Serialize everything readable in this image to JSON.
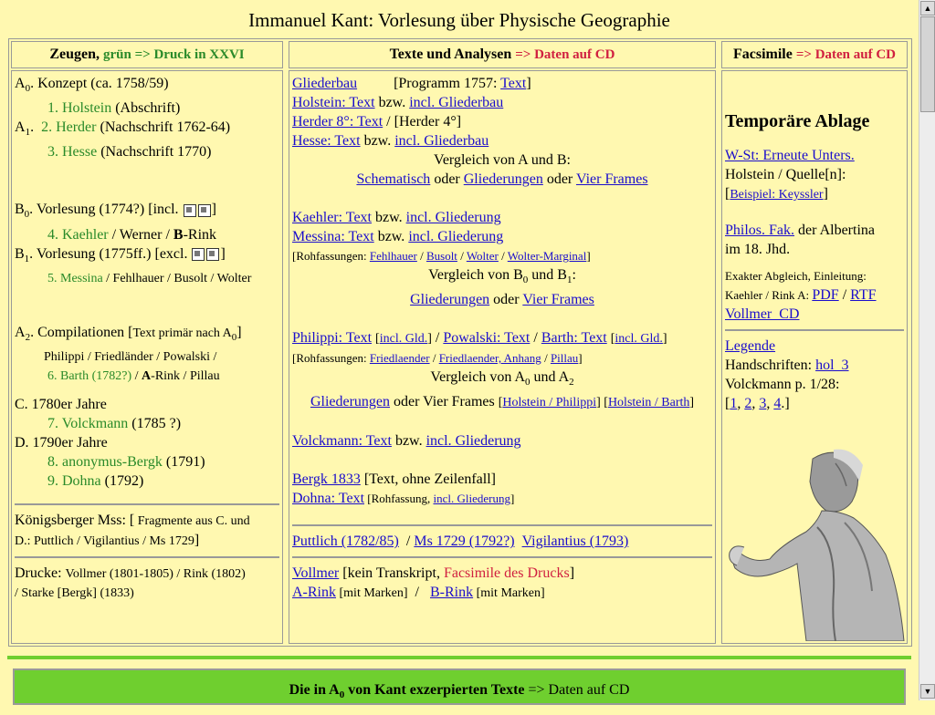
{
  "title": "Immanuel Kant: Vorlesung über Physische Geographie",
  "colors": {
    "background": "#FFF8B0",
    "link": "#1A0DCC",
    "green": "#2A8A2A",
    "red": "#D02040",
    "bar": "#6FCF2F"
  },
  "col1": {
    "header_bold": "Zeugen,",
    "header_green": "grün => Druck in XXVI",
    "a0": {
      "label": "A",
      "sub": "0",
      "text": ". Konzept (ca. 1758/59)"
    },
    "a0_1": {
      "num": "1. Holstein",
      "rest": " (Abschrift)"
    },
    "a1_label": {
      "label": "A",
      "sub": "1",
      "text": "."
    },
    "a1_2": {
      "num": "2. Herder",
      "rest": " (Nachschrift 1762-64)"
    },
    "a1_3": {
      "num": "3. Hesse",
      "rest": " (Nachschrift 1770)"
    },
    "b0": {
      "label": "B",
      "sub": "0",
      "text": ". Vorlesung (1774?) [incl. ",
      "close": "]"
    },
    "b0_4": {
      "num": "4. Kaehler",
      "sep1": " / Werner / ",
      "bold": "B",
      "rest": "-Rink"
    },
    "b1": {
      "label": "B",
      "sub": "1",
      "text": ". Vorlesung (1775ff.) [excl. ",
      "close": "]"
    },
    "b1_5": {
      "num": "5. Messina",
      "rest": " / Fehlhauer / Busolt / Wolter"
    },
    "a2": {
      "label": "A",
      "sub": "2",
      "text": ". Compilationen [",
      "small": "Text primär nach A",
      "small_sub": "0",
      "close": "]"
    },
    "a2_line2": "Philippi / Friedländer / Powalski /",
    "a2_6": {
      "num": "6. Barth (1782?)",
      "sep": " / ",
      "bold": "A",
      "rest": "-Rink / Pillau"
    },
    "c": "C. 1780er Jahre",
    "c_7": {
      "num": "7. Volckmann",
      "rest": " (1785 ?)"
    },
    "d": "D. 1790er Jahre",
    "d_8": {
      "num": "8. anonymus-Bergk",
      "rest": " (1791)"
    },
    "d_9": {
      "num": "9. Dohna",
      "rest": " (1792)"
    },
    "koenigsberger_1": "Königsberger Mss: [",
    "koenigsberger_1_small": " Fragmente aus C. und",
    "koenigsberger_2_small": "D.:  Puttlich / Vigilantius / Ms 1729",
    "koenigsberger_2_close": "]",
    "drucke_label": "Drucke: ",
    "drucke_1": " Vollmer (1801-1805) / Rink (1802)",
    "drucke_2": "/ Starke [Bergk] (1833)"
  },
  "col2": {
    "header_bold": "Texte und Analysen",
    "header_red": "=> Daten auf CD",
    "l1_link": "Gliederbau",
    "l1_text": "[Programm 1757: ",
    "l1_link2": "Text",
    "l1_close": "]",
    "l2_link": "Holstein: Text",
    "l2_text": " bzw. ",
    "l2_link2": "incl. Gliederbau",
    "l3_link": "Herder 8°: Text",
    "l3_text": " /  [Herder 4°]",
    "l4_link": "Hesse: Text",
    "l4_text": " bzw. ",
    "l4_link2": "incl. Gliederbau",
    "l5": "Vergleich von A und B:",
    "l6_link1": "Schematisch",
    "l6_t1": " oder ",
    "l6_link2": "Gliederungen",
    "l6_t2": " oder ",
    "l6_link3": "Vier Frames",
    "l7_link": "Kaehler: Text",
    "l7_text": " bzw. ",
    "l7_link2": "incl. Gliederung",
    "l8_link": "Messina: Text",
    "l8_text": " bzw. ",
    "l8_link2": "incl. Gliederung",
    "l9_pre": "[Rohfassungen: ",
    "l9_links": [
      "Fehlhauer",
      "Busolt",
      "Wolter",
      "Wolter-Marginal"
    ],
    "l9_close": "]",
    "l10": "Vergleich von B",
    "l10_sub1": "0",
    "l10_mid": " und B",
    "l10_sub2": "1",
    "l10_end": ":",
    "l11_link1": "Gliederungen",
    "l11_t": " oder ",
    "l11_link2": "Vier Frames",
    "l12_link1": "Philippi: Text",
    "l12_link1b": "incl. Gld.",
    "l12_link2": "Powalski: Text",
    "l12_link3": "Barth: Text",
    "l12_link3b": "incl. Gld.",
    "l13_pre": "[Rohfassungen: ",
    "l13_links": [
      "Friedlaender",
      "Friedlaender, Anhang",
      "Pillau"
    ],
    "l13_close": "]",
    "l14": "Vergleich von A",
    "l14_sub1": "0",
    "l14_mid": " und A",
    "l14_sub2": "2",
    "l15_link1": "Gliederungen",
    "l15_t": " oder Vier Frames ",
    "l15_link2": "Holstein / Philippi",
    "l15_link3": "Holstein / Barth",
    "l16_link": "Volckmann: Text",
    "l16_text": " bzw. ",
    "l16_link2": "incl. Gliederung",
    "l17_link": "Bergk 1833",
    "l17_text": " [Text, ohne Zeilenfall]",
    "l18_link": "Dohna: Text",
    "l18_pre": " [Rohfassung, ",
    "l18_link2": "incl. Gliederung",
    "l18_close": "]",
    "l19_link1": "Puttlich (1782/85)",
    "l19_link2": "Ms 1729 (1792?)",
    "l19_link3": "Vigilantius (1793)",
    "l20_link": "Vollmer",
    "l20_text": " [kein Transkript, ",
    "l20_red": "Facsimile des Drucks",
    "l20_close": "]",
    "l21_link1": "A-Rink",
    "l21_t1": " [mit Marken]",
    "l21_link2": "B-Rink",
    "l21_t2": " [mit Marken]"
  },
  "col3": {
    "header_bold": "Facsimile",
    "header_red": "=> Daten auf CD",
    "temp": "Temporäre Ablage",
    "ws_link": "W-St: Erneute Unters.",
    "holstein": "Holstein / Quelle[n]:",
    "beispiel_link": "Beispiel: Keyssler",
    "philos_link": "Philos. Fak.",
    "philos_text": " der Albertina",
    "philos_text2": "im 18. Jhd.",
    "exakt1": "Exakter Abgleich, Einleitung:",
    "exakt2": "Kaehler / Rink A: ",
    "pdf_link": "PDF",
    "rtf_link": "RTF",
    "vollmer_link": "Vollmer_CD",
    "legende_link": "Legende",
    "hand_text": "Handschriften: ",
    "hand_link": "hol_3",
    "volck": "Volckmann p. 1/28:",
    "pages": [
      "1",
      "2",
      "3",
      "4"
    ]
  },
  "bottom": {
    "bold": "Die in A",
    "sub": "0",
    "bold2": " von Kant exzerpierten Texte",
    "rest": " => Daten auf CD"
  }
}
